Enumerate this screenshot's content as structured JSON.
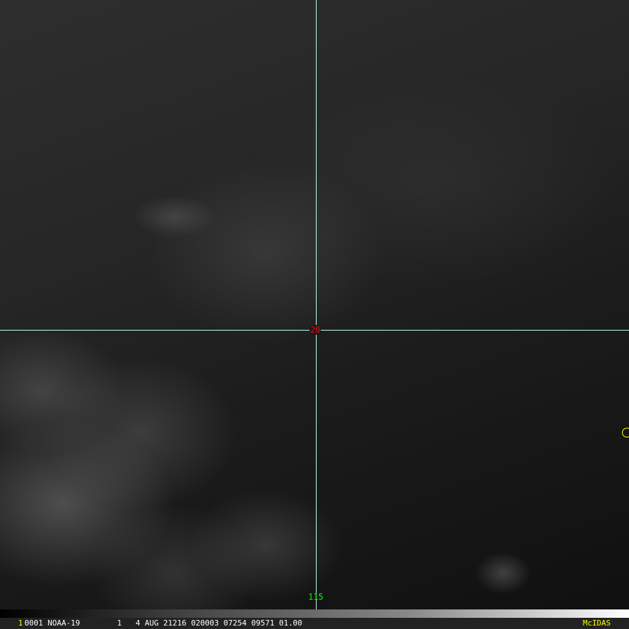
{
  "overlay": {
    "latitude_label": "20",
    "longitude_label": "115",
    "line_color": "#bbffee"
  },
  "status_bar": {
    "frame": "1",
    "info": "0001 NOAA-19        1   4 AUG 21216 020003 07254 09571 01.00",
    "brand": "McIDAS"
  }
}
